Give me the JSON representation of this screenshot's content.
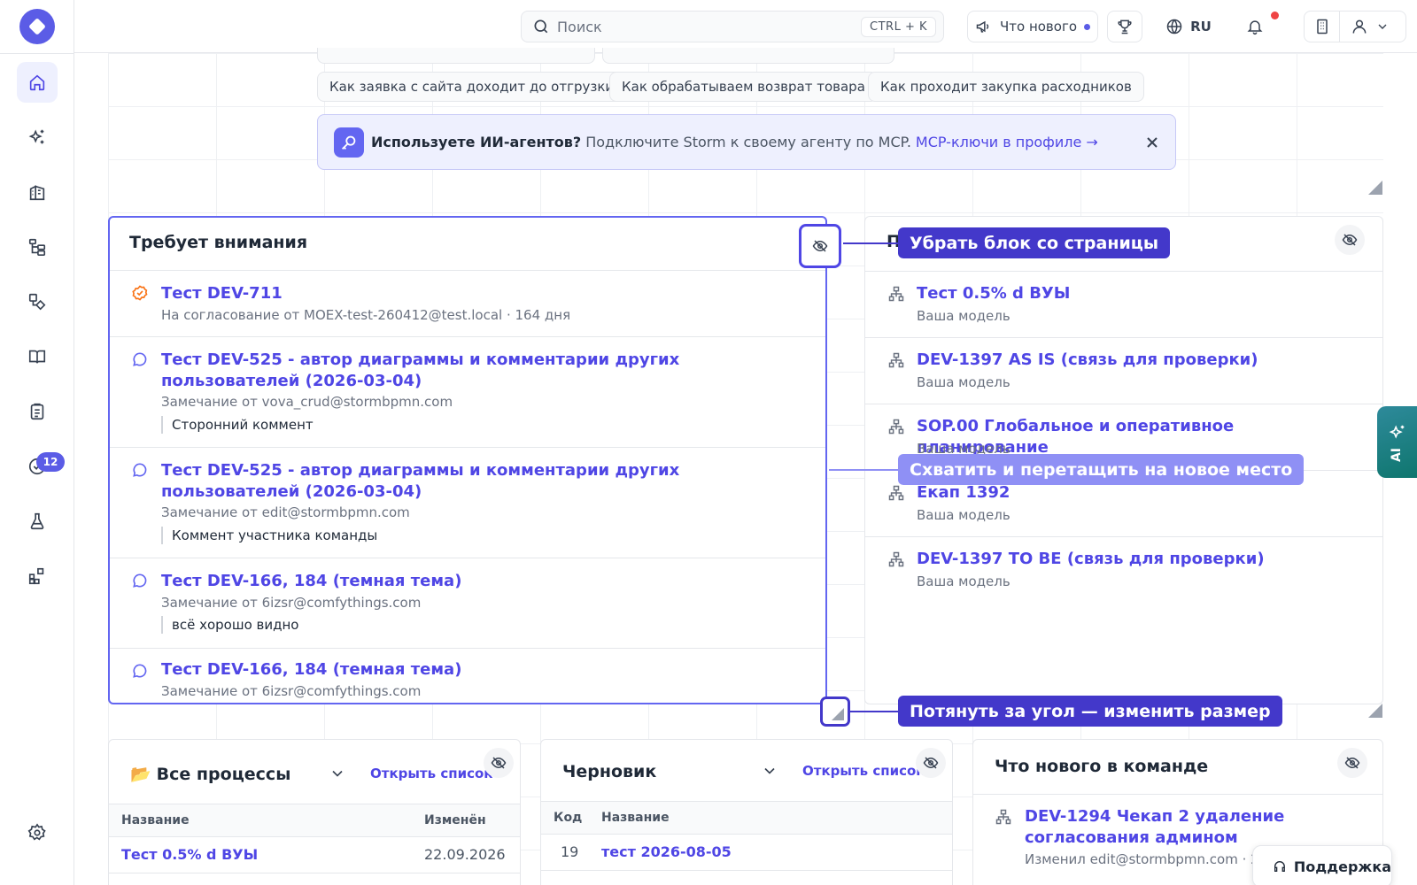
{
  "topbar": {
    "search_placeholder": "Поиск",
    "search_shortcut": "CTRL + K",
    "whats_new": "Что нового",
    "language": "RU"
  },
  "sidebar": {
    "tasks_badge": "12"
  },
  "quick_chips": [
    "Как заявка с сайта доходит до отгрузки",
    "Как обрабатываем возврат товара",
    "Как проходит закупка расходников"
  ],
  "banner": {
    "bold": "Используете ИИ-агентов?",
    "text": "Подключите Storm к своему агенту по MCP.",
    "link": "MCP-ключи в профиле →"
  },
  "attention": {
    "title": "Требует внимания",
    "items": [
      {
        "title": "Тест DEV-711",
        "sub": "На согласование от MOEX-test-260412@test.local · 164 дня",
        "quote": ""
      },
      {
        "title": "Тест DEV-525 - автор диаграммы и комментарии других пользователей (2026-03-04)",
        "sub": "Замечание от vova_crud@stormbpmn.com",
        "quote": "Сторонний коммент"
      },
      {
        "title": "Тест DEV-525 - автор диаграммы и комментарии других пользователей (2026-03-04)",
        "sub": "Замечание от edit@stormbpmn.com",
        "quote": "Коммент участника команды"
      },
      {
        "title": "Тест DEV-166, 184 (темная тема)",
        "sub": "Замечание от 6izsr@comfythings.com",
        "quote": "всё хорошо видно"
      },
      {
        "title": "Тест DEV-166, 184 (темная тема)",
        "sub": "Замечание от 6izsr@comfythings.com",
        "quote": ""
      }
    ]
  },
  "recent": {
    "title_initial": "П",
    "items": [
      {
        "title": "Тест 0.5% d ВУЫ",
        "sub": "Ваша модель"
      },
      {
        "title": "DEV-1397 AS IS (связь для проверки)",
        "sub": "Ваша модель"
      },
      {
        "title": "SOP.00 Глобальное и оперативное планирование",
        "sub": "Ваша модель"
      },
      {
        "title": "Екап 1392",
        "sub": "Ваша модель"
      },
      {
        "title": "DEV-1397 TO BE (связь для проверки)",
        "sub": "Ваша модель"
      }
    ]
  },
  "callouts": {
    "hide": "Убрать блок со страницы",
    "drag": "Схватить и перетащить на новое место",
    "resize": "Потянуть за угол — изменить размер"
  },
  "all_processes": {
    "title": "Все процессы",
    "open_link": "Открыть список",
    "col_name": "Название",
    "col_changed": "Изменён",
    "rows": [
      {
        "name": "Тест 0.5% d ВУЫ",
        "changed": "22.09.2026"
      }
    ]
  },
  "draft": {
    "title": "Черновик",
    "open_link": "Открыть список",
    "col_code": "Код",
    "col_name": "Название",
    "rows": [
      {
        "code": "19",
        "name": "тест 2026-08-05"
      }
    ]
  },
  "team_news": {
    "title": "Что нового в команде",
    "items": [
      {
        "title": "DEV-1294 Чекап 2 удаление согласования админом",
        "sub": "Изменил edit@stormbpmn.com · 2 д"
      }
    ]
  },
  "ai_tab": "AI",
  "support": "Поддержка",
  "colors": {
    "accent": "#4f46e5",
    "callout": "#4338ca",
    "ai_tab": "#0f766e"
  }
}
